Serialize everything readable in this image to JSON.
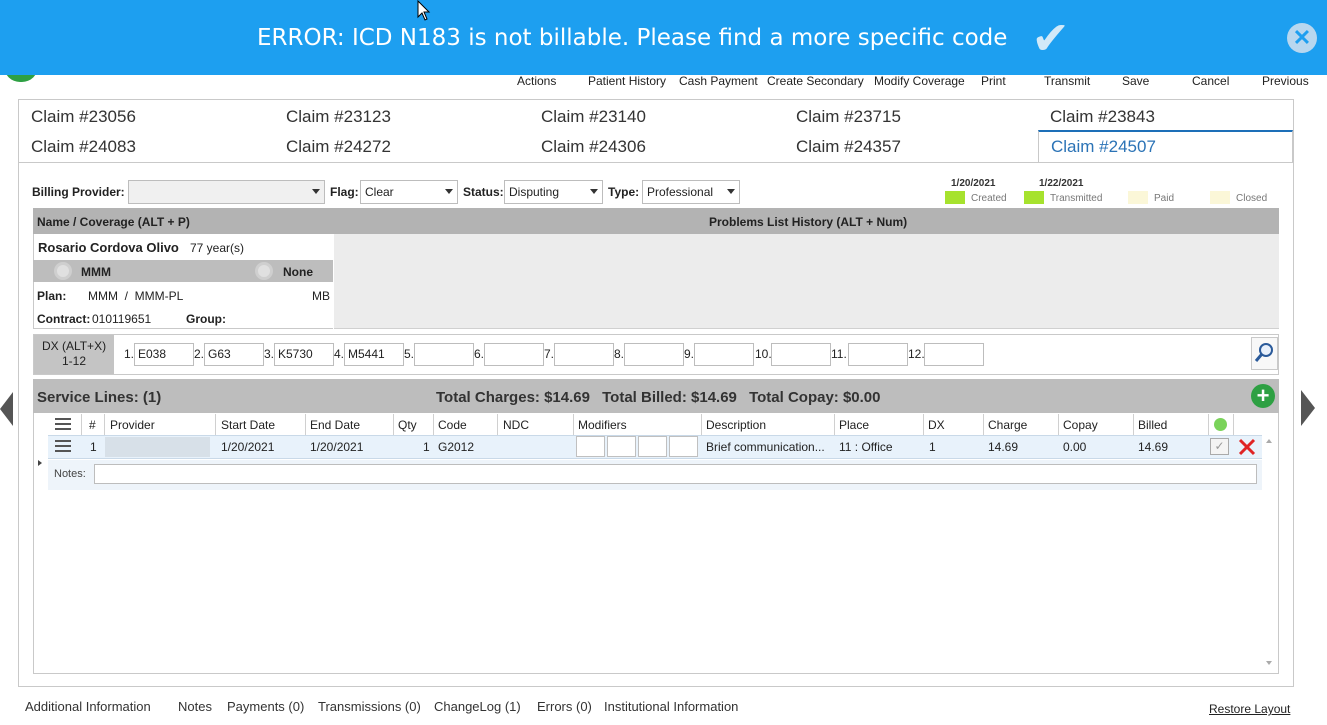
{
  "banner": {
    "message": "ERROR: ICD N183 is not billable. Please find a more specific code",
    "check_icon": "checkmark-icon",
    "close_icon": "close-circle-icon",
    "accent": "#1d9ff0"
  },
  "toolbar": {
    "actions": "Actions",
    "patient_history": "Patient History",
    "cash_payment": "Cash Payment",
    "create_secondary": "Create Secondary",
    "modify_coverage": "Modify Coverage",
    "print": "Print",
    "transmit": "Transmit",
    "save": "Save",
    "cancel": "Cancel",
    "previous": "Previous"
  },
  "claim_tabs": [
    "Claim #23056",
    "Claim #23123",
    "Claim #23140",
    "Claim #23715",
    "Claim #23843",
    "Claim #24083",
    "Claim #24272",
    "Claim #24306",
    "Claim #24357",
    "Claim #24507"
  ],
  "active_claim_tab": "Claim #24507",
  "filters": {
    "billing_provider_label": "Billing Provider:",
    "billing_provider_value": "",
    "flag_label": "Flag:",
    "flag_value": "Clear",
    "status_label": "Status:",
    "status_value": "Disputing",
    "type_label": "Type:",
    "type_value": "Professional"
  },
  "status_legend": {
    "created_date": "1/20/2021",
    "created": "Created",
    "transmitted_date": "1/22/2021",
    "transmitted": "Transmitted",
    "paid": "Paid",
    "closed": "Closed",
    "done_color": "#a6e22e",
    "pending_color": "#fbf7d8"
  },
  "coverage": {
    "header": "Name / Coverage (ALT + P)",
    "patient_name": "Rosario Cordova Olivo",
    "patient_age": "77 year(s)",
    "option_mmm": "MMM",
    "option_none": "None",
    "plan_label": "Plan:",
    "plan_value": "MMM  /  MMM-PL",
    "plan_code": "MB",
    "contract_label": "Contract:",
    "contract_value": "010119651",
    "group_label": "Group:",
    "group_value": ""
  },
  "problems": {
    "header": "Problems List History (ALT + Num)"
  },
  "dx": {
    "label": "DX (ALT+X)",
    "range": "1-12",
    "codes": [
      {
        "n": "1.",
        "v": "E038"
      },
      {
        "n": "2.",
        "v": "G63"
      },
      {
        "n": "3.",
        "v": "K5730"
      },
      {
        "n": "4.",
        "v": "M5441"
      },
      {
        "n": "5.",
        "v": ""
      },
      {
        "n": "6.",
        "v": ""
      },
      {
        "n": "7.",
        "v": ""
      },
      {
        "n": "8.",
        "v": ""
      },
      {
        "n": "9.",
        "v": ""
      },
      {
        "n": "10.",
        "v": ""
      },
      {
        "n": "11.",
        "v": ""
      },
      {
        "n": "12.",
        "v": ""
      }
    ]
  },
  "service_lines": {
    "title": "Service Lines: (1)",
    "total_charges": "Total Charges: $14.69",
    "total_billed": "Total Billed: $14.69",
    "total_copay": "Total Copay: $0.00",
    "columns": {
      "num": "#",
      "provider": "Provider",
      "start": "Start Date",
      "end": "End Date",
      "qty": "Qty",
      "code": "Code",
      "ndc": "NDC",
      "modifiers": "Modifiers",
      "description": "Description",
      "place": "Place",
      "dx": "DX",
      "charge": "Charge",
      "copay": "Copay",
      "billed": "Billed"
    },
    "rows": [
      {
        "num": "1",
        "provider": "",
        "start": "1/20/2021",
        "end": "1/20/2021",
        "qty": "1",
        "code": "G2012",
        "ndc": "",
        "description": "Brief communication...",
        "place": "11 : Office",
        "dx": "1",
        "charge": "14.69",
        "copay": "0.00",
        "billed": "14.69"
      }
    ],
    "notes_label": "Notes:"
  },
  "bottom_tabs": {
    "additional": "Additional Information",
    "notes": "Notes",
    "payments": "Payments (0)",
    "transmissions": "Transmissions (0)",
    "changelog": "ChangeLog (1)",
    "errors": "Errors (0)",
    "institutional": "Institutional Information",
    "restore": "Restore Layout"
  }
}
